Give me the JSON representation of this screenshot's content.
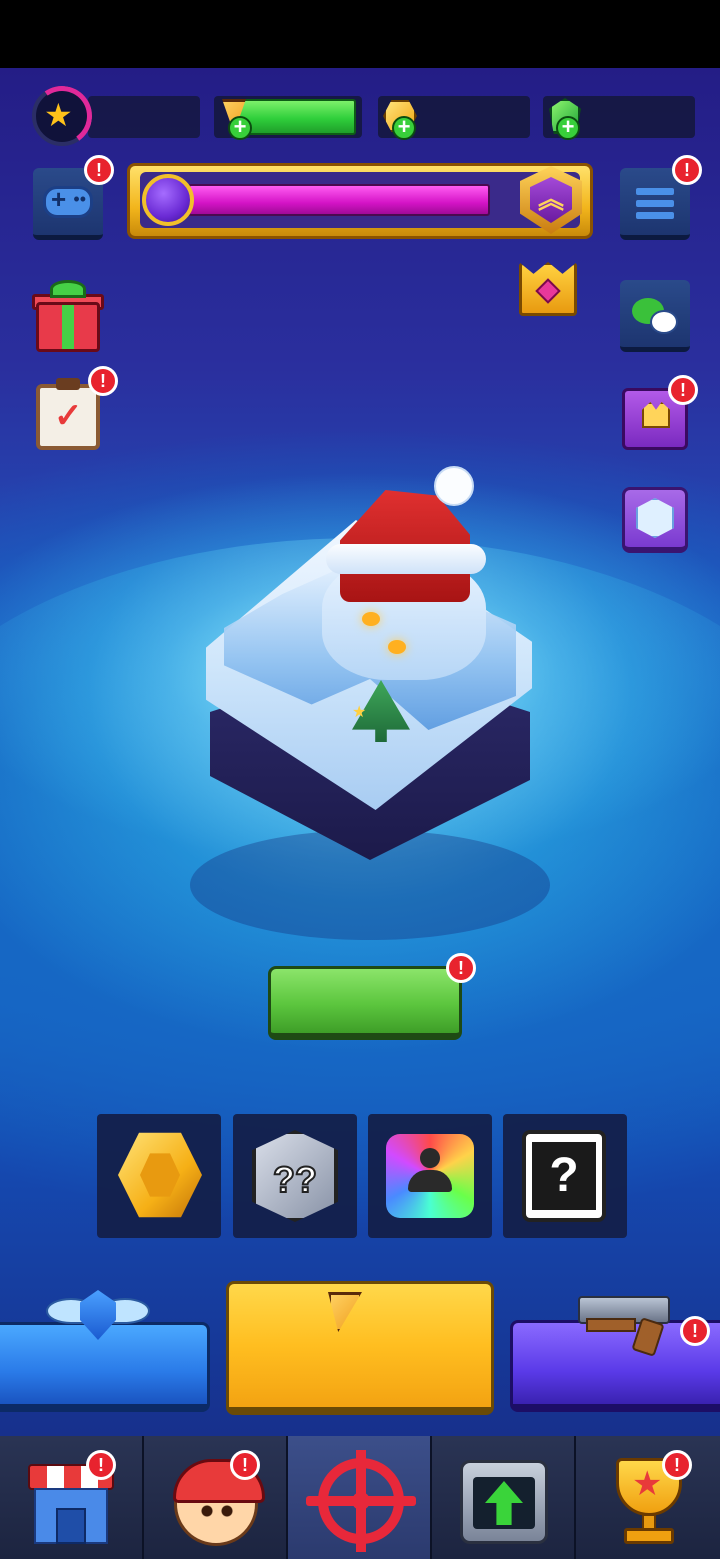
{
  "header": {
    "level_progress_pct": 30,
    "energy_fill_pct": 100,
    "icons": {
      "level": "star-icon",
      "energy": "pizza-icon",
      "coins": "hex-coin-icon",
      "gems": "green-gem-icon",
      "add": "plus-icon"
    }
  },
  "season_bar": {
    "progress_pct": 95,
    "icons": {
      "knob": "purple-orb-icon",
      "rank": "rank-chevron-shield-icon"
    }
  },
  "badges": {
    "alert": "!"
  },
  "side_left": [
    {
      "id": "game-modes",
      "icon": "gamepad-icon",
      "alert": true
    },
    {
      "id": "gift",
      "icon": "gift-icon",
      "alert": false
    },
    {
      "id": "tasks",
      "icon": "clipboard-check-icon",
      "alert": true
    }
  ],
  "side_right": [
    {
      "id": "menu",
      "icon": "hamburger-menu-icon",
      "alert": true
    },
    {
      "id": "crown-chest",
      "icon": "crown-chest-icon",
      "alert": false
    },
    {
      "id": "chat",
      "icon": "wechat-icon",
      "alert": false
    },
    {
      "id": "royal-chest",
      "icon": "purple-chest-icon",
      "alert": true
    },
    {
      "id": "cube",
      "icon": "ice-cube-icon",
      "alert": false
    }
  ],
  "scene": {
    "base_name": "snow-yeti-fortress",
    "decor": "christmas-tree"
  },
  "rewards": [
    {
      "id": "coin",
      "icon": "gold-coin-icon"
    },
    {
      "id": "dice",
      "icon": "mystery-dice-icon",
      "glyph": "??"
    },
    {
      "id": "avatar",
      "icon": "rainbow-avatar-icon"
    },
    {
      "id": "mystery",
      "icon": "mystery-card-icon",
      "glyph": "?"
    }
  ],
  "actions": [
    {
      "id": "rank",
      "icon": "winged-shield-icon",
      "color": "#2a7ae8"
    },
    {
      "id": "play",
      "icon": "pizza-slice-icon",
      "color": "#ffbe20"
    },
    {
      "id": "weapon",
      "icon": "revolver-icon",
      "color": "#5a3ae8",
      "alert": true
    }
  ],
  "nav": [
    {
      "id": "shop",
      "icon": "shop-icon",
      "alert": true,
      "active": false
    },
    {
      "id": "hero",
      "icon": "hero-avatar-icon",
      "alert": true,
      "active": false
    },
    {
      "id": "battle",
      "icon": "crosshair-icon",
      "alert": false,
      "active": true
    },
    {
      "id": "upgrade",
      "icon": "upgrade-arrow-icon",
      "alert": false,
      "active": false
    },
    {
      "id": "trophies",
      "icon": "trophy-icon",
      "alert": true,
      "active": false
    }
  ],
  "colors": {
    "alert": "#e8232e",
    "energy": "#2fcf3b",
    "season_fill": "#d414c6",
    "frame_gold": "#f2b51c"
  }
}
